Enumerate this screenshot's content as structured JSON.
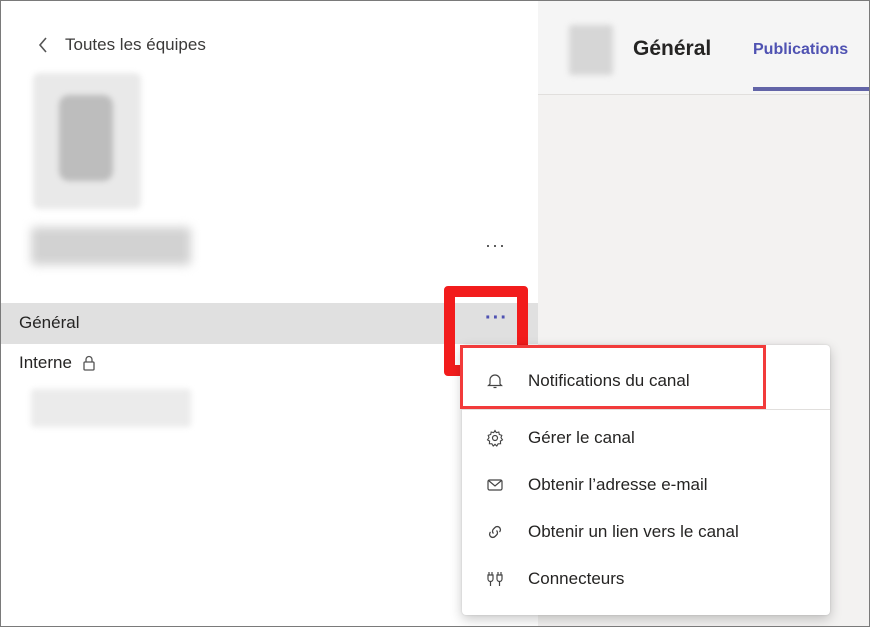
{
  "sidebar": {
    "back_label": "Toutes les équipes",
    "team_more": "···",
    "channels": [
      {
        "name": "Général",
        "more": "···"
      },
      {
        "name": "Interne"
      }
    ]
  },
  "header": {
    "channel_title": "Général",
    "active_tab": "Publications"
  },
  "context_menu": {
    "items": [
      {
        "label": "Notifications du canal",
        "icon": "bell-icon"
      },
      {
        "label": "Gérer le canal",
        "icon": "gear-icon"
      },
      {
        "label": "Obtenir l’adresse e-mail",
        "icon": "mail-icon"
      },
      {
        "label": "Obtenir un lien vers le canal",
        "icon": "link-icon"
      },
      {
        "label": "Connecteurs",
        "icon": "connector-icon"
      }
    ]
  },
  "colors": {
    "accent": "#6264a7",
    "highlight": "#f21c1c",
    "selected_row": "#e0e0e0"
  }
}
